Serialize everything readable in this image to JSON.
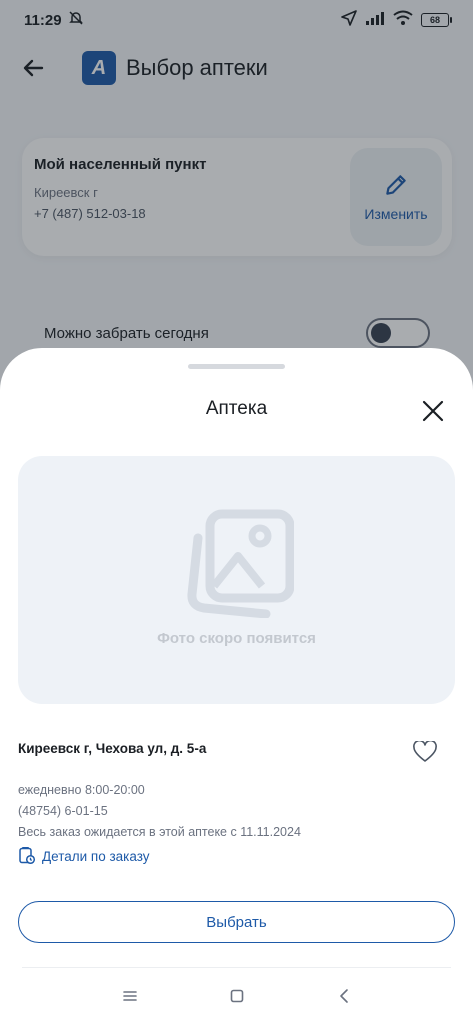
{
  "status_bar": {
    "time": "11:29",
    "battery": "68"
  },
  "header": {
    "title": "Выбор аптеки",
    "logo_letter": "A"
  },
  "location_card": {
    "title": "Мой населенный пункт",
    "city": "Киреевск г",
    "phone": "+7 (487) 512-03-18",
    "change_label": "Изменить"
  },
  "filters": {
    "today_label": "Можно забрать сегодня",
    "today_enabled": false
  },
  "sheet": {
    "title": "Аптека",
    "photo_placeholder": "Фото скоро появится",
    "address": "Киреевск г, Чехова ул, д. 5-а",
    "hours": "ежедневно 8:00-20:00",
    "phone": "(48754) 6-01-15",
    "order_note": "Весь заказ ожидается в этой аптеке с 11.11.2024",
    "details_link": "Детали по заказу",
    "choose_label": "Выбрать"
  },
  "colors": {
    "accent": "#1e5aa8",
    "scrim": "#1e242e"
  }
}
